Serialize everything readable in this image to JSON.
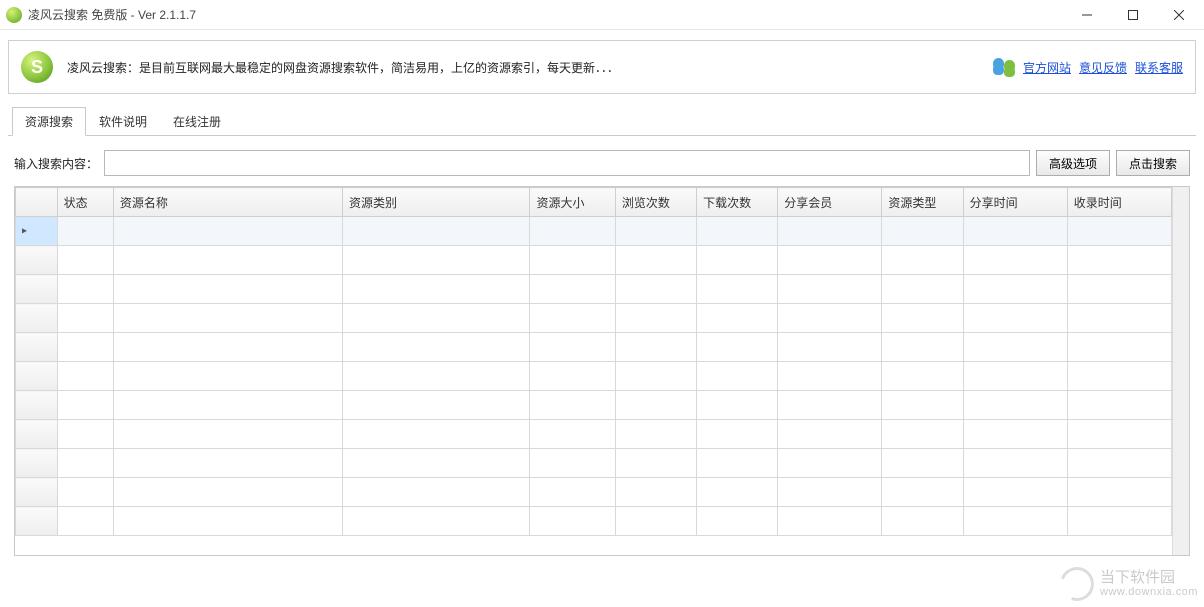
{
  "window": {
    "title": "凌风云搜索   免费版 - Ver 2.1.1.7"
  },
  "info": {
    "icon_letter": "S",
    "description": "凌风云搜索：是目前互联网最大最稳定的网盘资源搜索软件，简洁易用，上亿的资源索引，每天更新．．．",
    "links": {
      "official": "官方网站",
      "feedback": "意见反馈",
      "support": "联系客服"
    }
  },
  "tabs": [
    {
      "id": "search",
      "label": "资源搜索",
      "active": true
    },
    {
      "id": "about",
      "label": "软件说明",
      "active": false
    },
    {
      "id": "register",
      "label": "在线注册",
      "active": false
    }
  ],
  "search": {
    "label": "输入搜索内容：",
    "value": "",
    "adv_button": "高级选项",
    "go_button": "点击搜索"
  },
  "grid": {
    "columns": [
      {
        "key": "status",
        "label": "状态"
      },
      {
        "key": "name",
        "label": "资源名称"
      },
      {
        "key": "category",
        "label": "资源类别"
      },
      {
        "key": "size",
        "label": "资源大小"
      },
      {
        "key": "views",
        "label": "浏览次数"
      },
      {
        "key": "downloads",
        "label": "下载次数"
      },
      {
        "key": "member",
        "label": "分享会员"
      },
      {
        "key": "type",
        "label": "资源类型"
      },
      {
        "key": "share_time",
        "label": "分享时间"
      },
      {
        "key": "record_time",
        "label": "收录时间"
      }
    ],
    "rows": [
      {
        "selected": true,
        "cells": [
          "",
          "",
          "",
          "",
          "",
          "",
          "",
          "",
          "",
          ""
        ]
      },
      {
        "selected": false,
        "cells": [
          "",
          "",
          "",
          "",
          "",
          "",
          "",
          "",
          "",
          ""
        ]
      },
      {
        "selected": false,
        "cells": [
          "",
          "",
          "",
          "",
          "",
          "",
          "",
          "",
          "",
          ""
        ]
      },
      {
        "selected": false,
        "cells": [
          "",
          "",
          "",
          "",
          "",
          "",
          "",
          "",
          "",
          ""
        ]
      },
      {
        "selected": false,
        "cells": [
          "",
          "",
          "",
          "",
          "",
          "",
          "",
          "",
          "",
          ""
        ]
      },
      {
        "selected": false,
        "cells": [
          "",
          "",
          "",
          "",
          "",
          "",
          "",
          "",
          "",
          ""
        ]
      },
      {
        "selected": false,
        "cells": [
          "",
          "",
          "",
          "",
          "",
          "",
          "",
          "",
          "",
          ""
        ]
      },
      {
        "selected": false,
        "cells": [
          "",
          "",
          "",
          "",
          "",
          "",
          "",
          "",
          "",
          ""
        ]
      },
      {
        "selected": false,
        "cells": [
          "",
          "",
          "",
          "",
          "",
          "",
          "",
          "",
          "",
          ""
        ]
      },
      {
        "selected": false,
        "cells": [
          "",
          "",
          "",
          "",
          "",
          "",
          "",
          "",
          "",
          ""
        ]
      },
      {
        "selected": false,
        "cells": [
          "",
          "",
          "",
          "",
          "",
          "",
          "",
          "",
          "",
          ""
        ]
      }
    ]
  },
  "watermark": {
    "name": "当下软件园",
    "url": "www.downxia.com"
  }
}
